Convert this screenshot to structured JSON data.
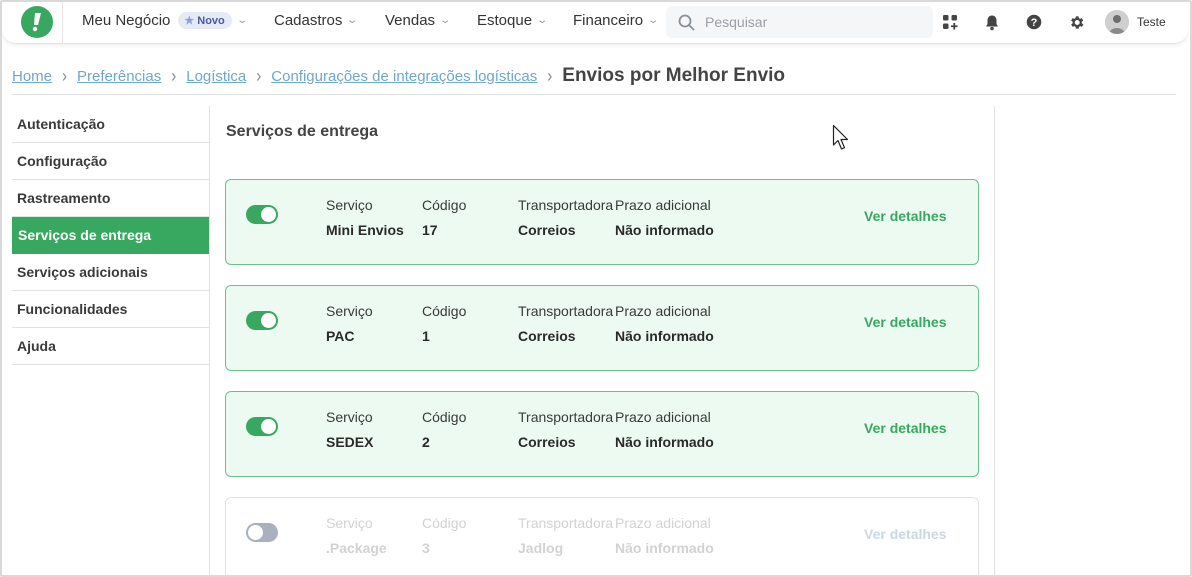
{
  "topbar": {
    "nav": [
      {
        "label": "Meu Negócio",
        "badge": "Novo"
      },
      {
        "label": "Cadastros"
      },
      {
        "label": "Vendas"
      },
      {
        "label": "Estoque"
      },
      {
        "label": "Financeiro"
      }
    ],
    "search_placeholder": "Pesquisar",
    "user_name": "Teste"
  },
  "breadcrumb": {
    "links": [
      "Home",
      "Preferências",
      "Logística",
      "Configurações de integrações logísticas"
    ],
    "current": "Envios por Melhor Envio"
  },
  "sidebar": {
    "items": [
      {
        "label": "Autenticação",
        "active": false
      },
      {
        "label": "Configuração",
        "active": false
      },
      {
        "label": "Rastreamento",
        "active": false
      },
      {
        "label": "Serviços de entrega",
        "active": true
      },
      {
        "label": "Serviços adicionais",
        "active": false
      },
      {
        "label": "Funcionalidades",
        "active": false
      },
      {
        "label": "Ajuda",
        "active": false
      }
    ]
  },
  "main": {
    "title": "Serviços de entrega",
    "labels": {
      "servico": "Serviço",
      "codigo": "Código",
      "transportadora": "Transportadora",
      "prazo": "Prazo adicional",
      "details": "Ver detalhes"
    },
    "services": [
      {
        "name": "Mini Envios",
        "code": "17",
        "carrier": "Correios",
        "prazo": "Não informado",
        "enabled": true
      },
      {
        "name": "PAC",
        "code": "1",
        "carrier": "Correios",
        "prazo": "Não informado",
        "enabled": true
      },
      {
        "name": "SEDEX",
        "code": "2",
        "carrier": "Correios",
        "prazo": "Não informado",
        "enabled": true
      },
      {
        "name": ".Package",
        "code": "3",
        "carrier": "Jadlog",
        "prazo": "Não informado",
        "enabled": false
      }
    ]
  },
  "colors": {
    "accent": "#38a861",
    "card_bg": "#edfaf1",
    "link": "#6fa8c8"
  }
}
